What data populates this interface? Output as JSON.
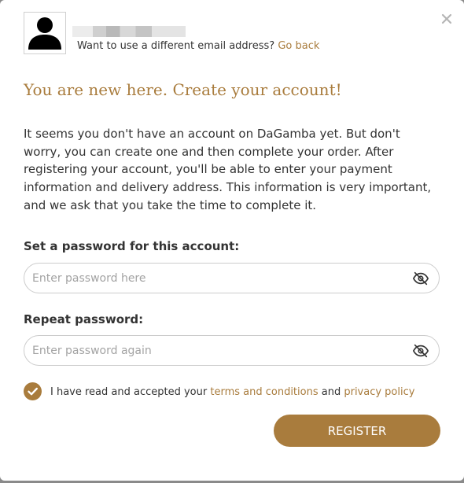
{
  "colors": {
    "accent": "#a97c3d",
    "text": "#333333",
    "border": "#cccccc"
  },
  "header": {
    "avatar_icon": "user-silhouette-icon",
    "change_email_text": "Want to use a different email address? ",
    "go_back_label": "Go back",
    "close_icon": "close-icon"
  },
  "title": "You are new here. Create your account!",
  "description": "It seems you don't have an account on DaGamba yet. But don't worry, you can create one and then complete your order. After registering your account, you'll be able to enter your payment information and delivery address. This information is very important, and we ask that you take the time to complete it.",
  "password": {
    "label": "Set a password for this account:",
    "placeholder": "Enter password here",
    "value": "",
    "toggle_icon": "eye-slash-icon"
  },
  "repeat_password": {
    "label": "Repeat password:",
    "placeholder": "Enter password again",
    "value": "",
    "toggle_icon": "eye-slash-icon"
  },
  "terms": {
    "checked": true,
    "prefix": "I have read and accepted your ",
    "terms_link": "terms and conditions",
    "middle": " and ",
    "privacy_link": "privacy policy"
  },
  "register_label": "REGISTER"
}
